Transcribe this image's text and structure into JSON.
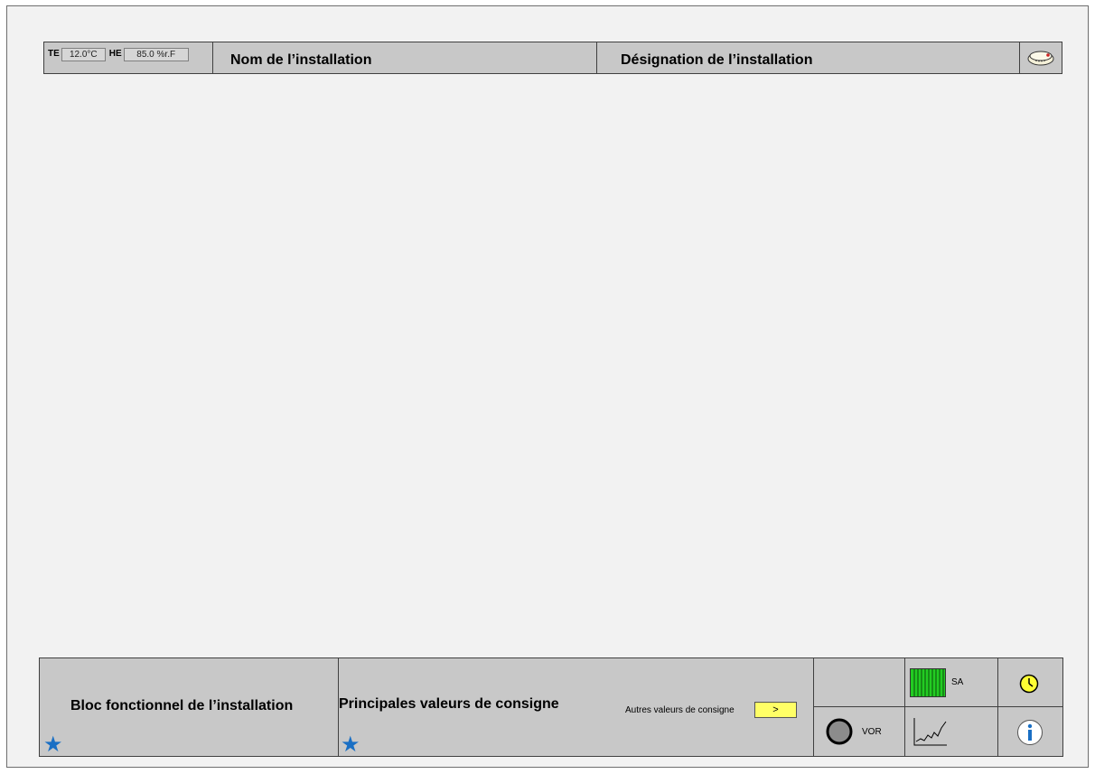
{
  "header": {
    "te_label": "TE",
    "te_value": "12.0°C",
    "he_label": "HE",
    "he_value": "85.0 %r.F",
    "installation_name": "Nom de l’installation",
    "installation_designation": "Désignation de l’installation",
    "alarm_icon": "alarm-horn-icon"
  },
  "footer": {
    "functional_block": "Bloc fonctionnel de l’installation",
    "main_setpoints": "Principales valeurs de consigne",
    "other_setpoints": "Autres valeurs de consigne",
    "next_button": ">",
    "vor_label": "VOR",
    "sa_label": "SA",
    "icons": {
      "favorite": "star-icon",
      "clock": "clock-icon",
      "info": "info-icon",
      "trend": "trend-chart-icon",
      "status": "status-circle-icon",
      "heater": "green-radiator-icon"
    },
    "colors": {
      "star": "#1a6fc4",
      "button": "#ffff66",
      "heater": "#22cc22",
      "clock": "#ffff33",
      "info": "#1a6fc4"
    }
  }
}
